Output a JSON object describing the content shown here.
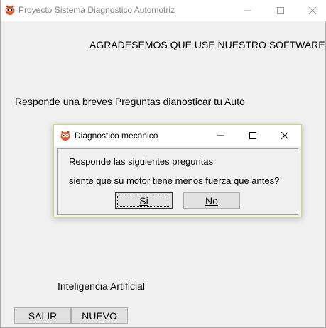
{
  "window": {
    "title": "Proyecto Sistema Diagnostico Automotriz"
  },
  "main": {
    "thanks_label": "AGRADESEMOS QUE USE NUESTRO SOFTWARE",
    "respond_label": "Responde una breves Preguntas dianosticar tu Auto",
    "ai_label": "Inteligencia Artificial",
    "exit_button": "SALIR",
    "new_button": "NUEVO"
  },
  "dialog": {
    "title": "Diagnostico mecanico",
    "line1": "Responde las siguientes preguntas",
    "line2": "siente que su motor tiene menos fuerza que antes?",
    "yes_button": "Si",
    "no_button": "No"
  },
  "colors": {
    "app_icon": "#d9532c",
    "dialog_border": "#d8d27a"
  },
  "icons": {
    "app": "owl-app-icon",
    "minimize": "minimize-icon",
    "maximize": "maximize-icon",
    "close": "close-icon"
  }
}
